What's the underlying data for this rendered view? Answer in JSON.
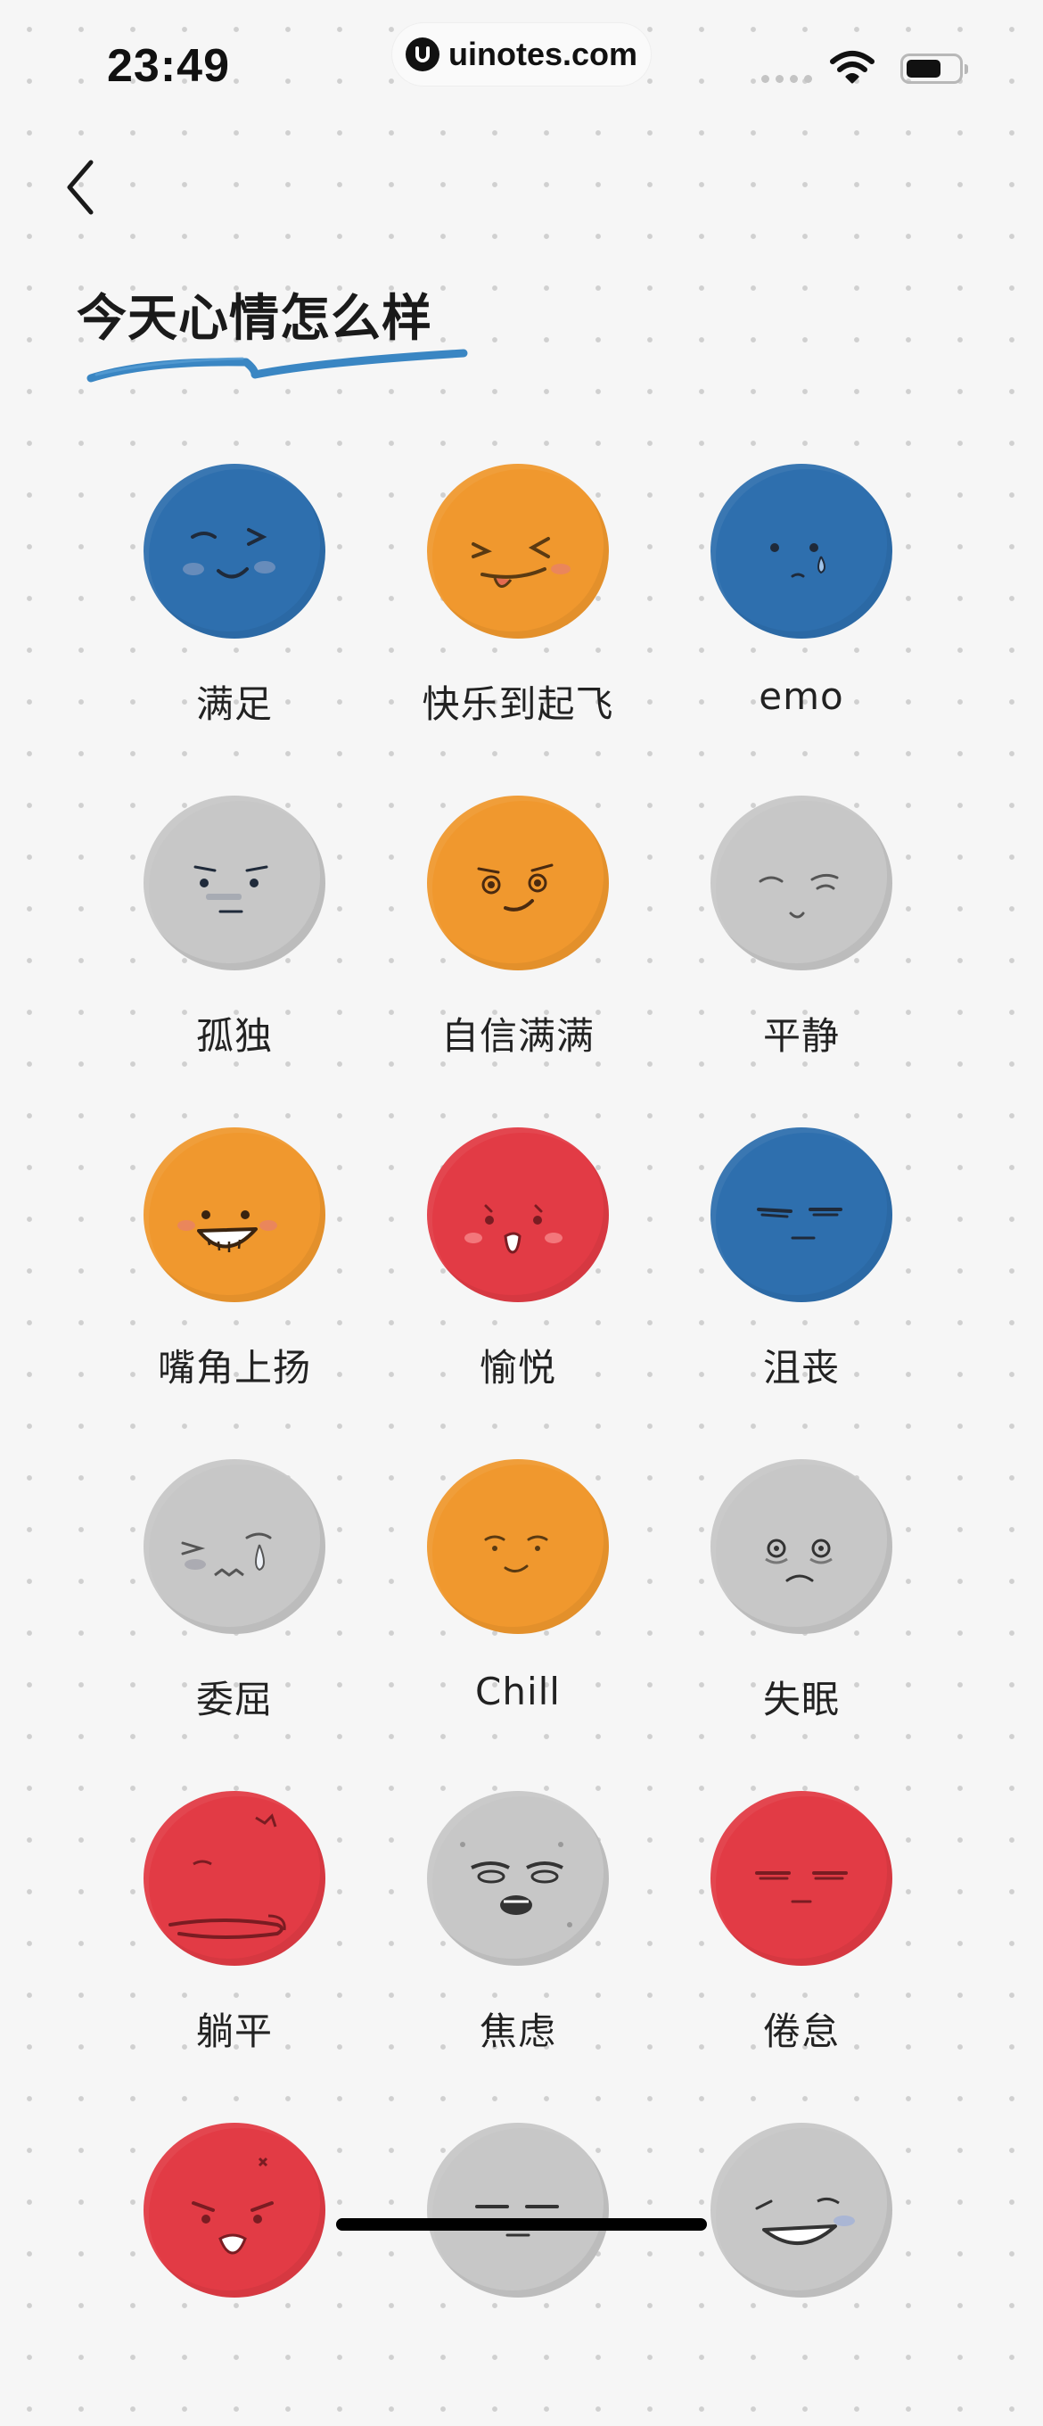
{
  "status_bar": {
    "time": "23:49",
    "url": "uinotes.com"
  },
  "header": {
    "title": "今天心情怎么样",
    "brush_color": "#2f7fc0"
  },
  "colors": {
    "blue": "#2e6fae",
    "orange": "#f0982e",
    "gray": "#c7c7c7",
    "red": "#e23b45"
  },
  "moods": [
    {
      "label": "满足",
      "color": "blue",
      "expression": "happy-closed-eyes"
    },
    {
      "label": "快乐到起飞",
      "color": "orange",
      "expression": "squint-tongue-out"
    },
    {
      "label": "emo",
      "color": "blue",
      "expression": "tearful"
    },
    {
      "label": "孤独",
      "color": "gray",
      "expression": "lonely"
    },
    {
      "label": "自信满满",
      "color": "orange",
      "expression": "smirk"
    },
    {
      "label": "平静",
      "color": "gray",
      "expression": "calm-wink"
    },
    {
      "label": "嘴角上扬",
      "color": "orange",
      "expression": "grin"
    },
    {
      "label": "愉悦",
      "color": "red",
      "expression": "delighted"
    },
    {
      "label": "沮丧",
      "color": "blue",
      "expression": "dejected"
    },
    {
      "label": "委屈",
      "color": "gray",
      "expression": "aggrieved"
    },
    {
      "label": "Chill",
      "color": "orange",
      "expression": "relaxed"
    },
    {
      "label": "失眠",
      "color": "gray",
      "expression": "sleepless"
    },
    {
      "label": "躺平",
      "color": "red",
      "expression": "lying-flat"
    },
    {
      "label": "焦虑",
      "color": "gray",
      "expression": "anxious"
    },
    {
      "label": "倦怠",
      "color": "red",
      "expression": "weary"
    },
    {
      "label": "",
      "color": "red",
      "expression": "angry"
    },
    {
      "label": "",
      "color": "gray",
      "expression": "annoyed"
    },
    {
      "label": "",
      "color": "gray",
      "expression": "laughing"
    }
  ]
}
